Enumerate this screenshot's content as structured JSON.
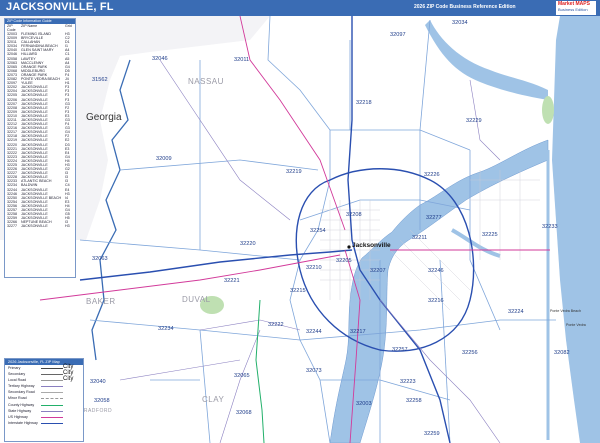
{
  "title": "JACKSONVILLE, FL",
  "edition": "2026 ZIP Code Business Reference Edition",
  "logo": {
    "line1": "Market",
    "line2": "MAPS",
    "line3": "Business Edition"
  },
  "colors": {
    "header": "#3a6cb4",
    "water": "#9fc3e6",
    "zip_border": "#7fa6da",
    "interstate": "#2a4fb0",
    "highway": "#d23a9a",
    "road": "#8a7fc0"
  },
  "zip_labels": [
    "32097",
    "32034",
    "31562",
    "32046",
    "32011",
    "32218",
    "32229",
    "32009",
    "32219",
    "32226",
    "32277",
    "32225",
    "32254",
    "32233",
    "32208",
    "32211",
    "32220",
    "32210",
    "32205",
    "32207",
    "32246",
    "32063",
    "32221",
    "32215",
    "32216",
    "32224",
    "32222",
    "32244",
    "32217",
    "32234",
    "32256",
    "32257",
    "32258",
    "32073",
    "32065",
    "32040",
    "32068",
    "32223",
    "32003",
    "32259",
    "32058",
    "32082"
  ],
  "county_labels": [
    "NASSAU",
    "BAKER",
    "DUVAL",
    "CLAY",
    "BRADFORD"
  ],
  "state_label": "Georgia",
  "city_label": "Jacksonville",
  "small_places": [
    "Ponte Vedra Beach",
    "Ponte Vedra"
  ],
  "zip_table": {
    "header": "ZIP Code Information Guide",
    "columns": [
      "ZIP Code",
      "ZIP Name",
      "Grid"
    ],
    "rows": [
      [
        "32003",
        "FLEMING ISLAND",
        "H3"
      ],
      [
        "32009",
        "BRYCEVILLE",
        "C2"
      ],
      [
        "32011",
        "CALLAHAN",
        "D1"
      ],
      [
        "32034",
        "FERNANDINA BEACH",
        "I1"
      ],
      [
        "32040",
        "GLEN SAINT MARY",
        "A4"
      ],
      [
        "32046",
        "HILLIARD",
        "C1"
      ],
      [
        "32058",
        "LAWTEY",
        "A5"
      ],
      [
        "32063",
        "MACCLENNY",
        "A4"
      ],
      [
        "32065",
        "ORANGE PARK",
        "G4"
      ],
      [
        "32068",
        "MIDDLEBURG",
        "D5"
      ],
      [
        "32073",
        "ORANGE PARK",
        "F4"
      ],
      [
        "32082",
        "PONTE VEDRA BEACH",
        "J4"
      ],
      [
        "32097",
        "YULEE",
        "H1"
      ],
      [
        "32202",
        "JACKSONVILLE",
        "F3"
      ],
      [
        "32204",
        "JACKSONVILLE",
        "F3"
      ],
      [
        "32205",
        "JACKSONVILLE",
        "F3"
      ],
      [
        "32206",
        "JACKSONVILLE",
        "F3"
      ],
      [
        "32207",
        "JACKSONVILLE",
        "G3"
      ],
      [
        "32208",
        "JACKSONVILLE",
        "F2"
      ],
      [
        "32209",
        "JACKSONVILLE",
        "F3"
      ],
      [
        "32210",
        "JACKSONVILLE",
        "E3"
      ],
      [
        "32211",
        "JACKSONVILLE",
        "G3"
      ],
      [
        "32212",
        "JACKSONVILLE",
        "F4"
      ],
      [
        "32216",
        "JACKSONVILLE",
        "G3"
      ],
      [
        "32217",
        "JACKSONVILLE",
        "G4"
      ],
      [
        "32218",
        "JACKSONVILLE",
        "F2"
      ],
      [
        "32219",
        "JACKSONVILLE",
        "E2"
      ],
      [
        "32220",
        "JACKSONVILLE",
        "D3"
      ],
      [
        "32221",
        "JACKSONVILLE",
        "E3"
      ],
      [
        "32222",
        "JACKSONVILLE",
        "E4"
      ],
      [
        "32223",
        "JACKSONVILLE",
        "G4"
      ],
      [
        "32224",
        "JACKSONVILLE",
        "H4"
      ],
      [
        "32225",
        "JACKSONVILLE",
        "H3"
      ],
      [
        "32226",
        "JACKSONVILLE",
        "G2"
      ],
      [
        "32227",
        "JACKSONVILLE",
        "I3"
      ],
      [
        "32228",
        "JACKSONVILLE",
        "I3"
      ],
      [
        "32233",
        "ATLANTIC BEACH",
        "I3"
      ],
      [
        "32234",
        "BALDWIN",
        "C4"
      ],
      [
        "32244",
        "JACKSONVILLE",
        "E4"
      ],
      [
        "32246",
        "JACKSONVILLE",
        "H3"
      ],
      [
        "32250",
        "JACKSONVILLE BEACH",
        "I4"
      ],
      [
        "32254",
        "JACKSONVILLE",
        "E3"
      ],
      [
        "32256",
        "JACKSONVILLE",
        "H4"
      ],
      [
        "32257",
        "JACKSONVILLE",
        "G4"
      ],
      [
        "32258",
        "JACKSONVILLE",
        "G5"
      ],
      [
        "32259",
        "JACKSONVILLE",
        "H5"
      ],
      [
        "32266",
        "NEPTUNE BEACH",
        "I3"
      ],
      [
        "32277",
        "JACKSONVILLE",
        "H3"
      ]
    ]
  },
  "legend": {
    "header": "2026 Jacksonville, FL ZIP Map",
    "items": [
      "Primary",
      "Secondary",
      "Local Road",
      "Tertiary Highway",
      "Secondary Road",
      "Minor Road",
      "County Highway",
      "State Highway",
      "US Highway",
      "Interstate Highway"
    ],
    "city_samples": [
      "City",
      "City",
      "City"
    ]
  }
}
